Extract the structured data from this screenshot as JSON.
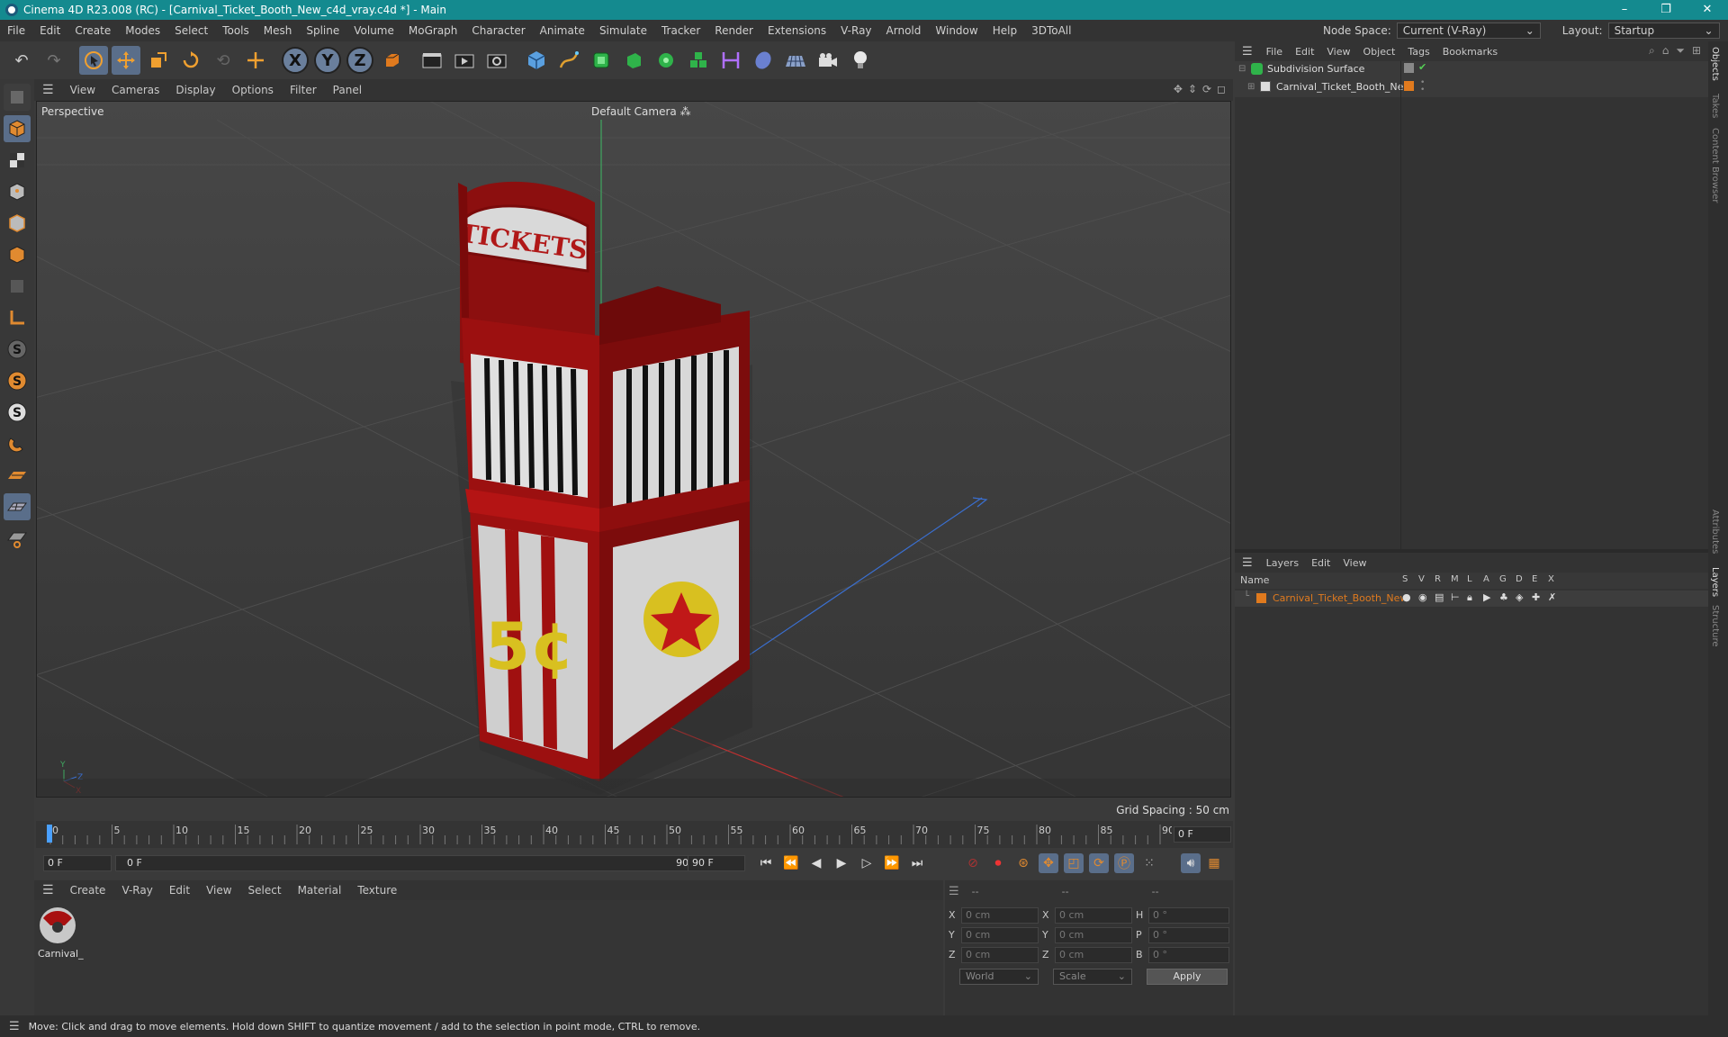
{
  "window": {
    "title": "Cinema 4D R23.008 (RC) - [Carnival_Ticket_Booth_New_c4d_vray.c4d *] - Main",
    "controls": [
      "–",
      "❐",
      "✕"
    ]
  },
  "menu": [
    "File",
    "Edit",
    "Create",
    "Modes",
    "Select",
    "Tools",
    "Mesh",
    "Spline",
    "Volume",
    "MoGraph",
    "Character",
    "Animate",
    "Simulate",
    "Tracker",
    "Render",
    "Extensions",
    "V-Ray",
    "Arnold",
    "Window",
    "Help",
    "3DToAll"
  ],
  "node_space": {
    "label": "Node Space:",
    "value": "Current (V-Ray)"
  },
  "layout": {
    "label": "Layout:",
    "value": "Startup"
  },
  "viewport": {
    "menu": [
      "View",
      "Cameras",
      "Display",
      "Options",
      "Filter",
      "Panel"
    ],
    "label": "Perspective",
    "camera": "Default Camera",
    "grid_spacing": "Grid Spacing : 50 cm",
    "sign_text": "TICKETS",
    "price_text": "5¢"
  },
  "timeline": {
    "ticks": [
      "0",
      "5",
      "10",
      "15",
      "20",
      "25",
      "30",
      "35",
      "40",
      "45",
      "50",
      "55",
      "60",
      "65",
      "70",
      "75",
      "80",
      "85",
      "90"
    ],
    "frame_end_box": "0 F"
  },
  "transport": {
    "current": "0 F",
    "range_start": "0 F",
    "range_end": "90 F",
    "end_field": "90 F"
  },
  "material_panel": {
    "menu": [
      "Create",
      "V-Ray",
      "Edit",
      "View",
      "Select",
      "Material",
      "Texture"
    ],
    "material_name": "Carnival_"
  },
  "coords": {
    "header": [
      "--",
      "--",
      "--"
    ],
    "rows": [
      {
        "a": "X",
        "av": "0 cm",
        "b": "X",
        "bv": "0 cm",
        "c": "H",
        "cv": "0 °"
      },
      {
        "a": "Y",
        "av": "0 cm",
        "b": "Y",
        "bv": "0 cm",
        "c": "P",
        "cv": "0 °"
      },
      {
        "a": "Z",
        "av": "0 cm",
        "b": "Z",
        "bv": "0 cm",
        "c": "B",
        "cv": "0 °"
      }
    ],
    "world": "World",
    "scale": "Scale",
    "apply": "Apply"
  },
  "objects_panel": {
    "menu": [
      "File",
      "Edit",
      "View",
      "Object",
      "Tags",
      "Bookmarks"
    ],
    "items": [
      {
        "name": "Subdivision Surface"
      },
      {
        "name": "Carnival_Ticket_Booth_New"
      }
    ]
  },
  "layers_panel": {
    "menu": [
      "Layers",
      "Edit",
      "View"
    ],
    "header_name": "Name",
    "columns": [
      "S",
      "V",
      "R",
      "M",
      "L",
      "A",
      "G",
      "D",
      "E",
      "X"
    ],
    "items": [
      {
        "name": "Carnival_Ticket_Booth_New"
      }
    ]
  },
  "vertical_tabs": [
    "Objects",
    "Takes",
    "Content Browser",
    "Attributes",
    "Layers",
    "Structure"
  ],
  "status": "Move: Click and drag to move elements. Hold down SHIFT to quantize movement / add to the selection in point mode, CTRL to remove.",
  "colors": {
    "titlebar": "#148a8f",
    "accent_orange": "#e07a1e",
    "booth_red": "#b01818"
  }
}
